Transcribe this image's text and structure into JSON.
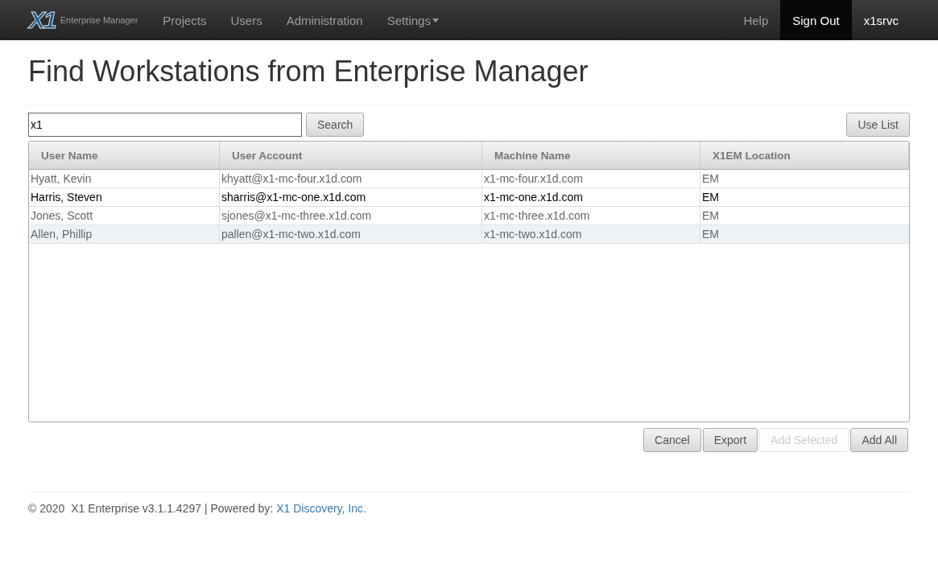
{
  "navbar": {
    "logo": "X1",
    "brand": "Enterprise Manager",
    "items": [
      {
        "label": "Projects",
        "kind": "link"
      },
      {
        "label": "Users",
        "kind": "link"
      },
      {
        "label": "Administration",
        "kind": "link"
      },
      {
        "label": "Settings",
        "kind": "dropdown"
      }
    ],
    "right_items": [
      {
        "label": "Help",
        "selected": false
      },
      {
        "label": "Sign Out",
        "selected": true
      },
      {
        "label": "x1srvc",
        "selected": false
      }
    ]
  },
  "title": "Find Workstations from Enterprise Manager",
  "search": {
    "value": "x1",
    "button": "Search"
  },
  "use_list_button": "Use List",
  "table": {
    "columns": [
      "User Name",
      "User Account",
      "Machine Name",
      "X1EM Location"
    ],
    "rows": [
      {
        "cells": [
          "Hyatt, Kevin",
          "khyatt@x1-mc-four.x1d.com",
          "x1-mc-four.x1d.com",
          "EM"
        ],
        "selected": false,
        "hovered": false
      },
      {
        "cells": [
          "Harris, Steven",
          "sharris@x1-mc-one.x1d.com",
          "x1-mc-one.x1d.com",
          "EM"
        ],
        "selected": true,
        "hovered": false
      },
      {
        "cells": [
          "Jones, Scott",
          "sjones@x1-mc-three.x1d.com",
          "x1-mc-three.x1d.com",
          "EM"
        ],
        "selected": false,
        "hovered": false
      },
      {
        "cells": [
          "Allen, Phillip",
          "pallen@x1-mc-two.x1d.com",
          "x1-mc-two.x1d.com",
          "EM"
        ],
        "selected": false,
        "hovered": true
      }
    ]
  },
  "actions": [
    {
      "label": "Cancel",
      "disabled": false
    },
    {
      "label": "Export",
      "disabled": false
    },
    {
      "label": "Add Selected",
      "disabled": true
    },
    {
      "label": "Add All",
      "disabled": false
    }
  ],
  "footer": {
    "text": "© 2020  X1 Enterprise v3.1.1.4297 | Powered by: ",
    "link": "X1 Discovery, Inc."
  }
}
